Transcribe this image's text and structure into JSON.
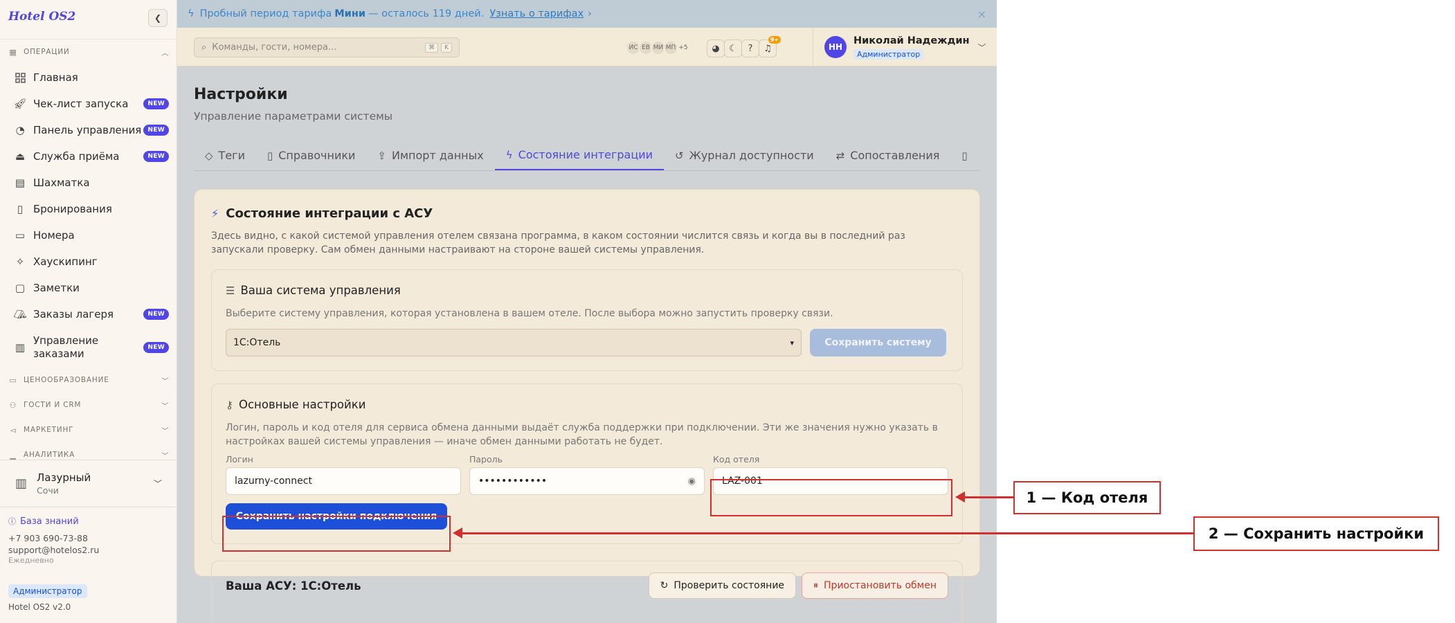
{
  "sidebar": {
    "brand": "Hotel OS2",
    "collapse_icon": "chevron-left-icon",
    "sections": {
      "operations": "ОПЕРАЦИИ",
      "pricing": "ЦЕНООБРАЗОВАНИЕ",
      "guests": "ГОСТИ И CRM",
      "marketing": "МАРКЕТИНГ",
      "analytics": "АНАЛИТИКА"
    },
    "items": [
      {
        "label": "Главная",
        "icon": "grid-icon",
        "badge": ""
      },
      {
        "label": "Чек-лист запуска",
        "icon": "rocket-icon",
        "badge": "NEW"
      },
      {
        "label": "Панель управления",
        "icon": "gauge-icon",
        "badge": "NEW"
      },
      {
        "label": "Служба приёма",
        "icon": "bell-icon",
        "badge": "NEW"
      },
      {
        "label": "Шахматка",
        "icon": "table-icon",
        "badge": ""
      },
      {
        "label": "Бронирования",
        "icon": "clipboard-icon",
        "badge": ""
      },
      {
        "label": "Номера",
        "icon": "door-icon",
        "badge": ""
      },
      {
        "label": "Хаускипинг",
        "icon": "sparkle-icon",
        "badge": ""
      },
      {
        "label": "Заметки",
        "icon": "note-icon",
        "badge": ""
      },
      {
        "label": "Заказы лагеря",
        "icon": "tent-icon",
        "badge": "NEW"
      },
      {
        "label": "Управление заказами",
        "icon": "receipt-icon",
        "badge": "NEW"
      }
    ],
    "hotel": {
      "name": "Лазурный",
      "city": "Сочи"
    },
    "footer": {
      "knowledge_base": "База знаний",
      "phone": "+7 903 690-73-88",
      "email": "support@hotelos2.ru",
      "hours": "Ежедневно",
      "role": "Администратор",
      "version": "Hotel OS2 v2.0"
    }
  },
  "trial_banner": {
    "text_before": "Пробный период тарифа",
    "plan": "Мини",
    "text_after": "— осталось 119 дней.",
    "link": "Узнать о тарифах",
    "link_arrow": "›",
    "close": "×"
  },
  "topbar": {
    "search_placeholder": "Команды, гости, номера...",
    "shortcut": [
      "⌘",
      "K"
    ],
    "avatars": [
      "ИС",
      "ЕВ",
      "МИ",
      "МП"
    ],
    "avatars_more": "+5",
    "notifications_count": "9+",
    "user": {
      "initials": "НН",
      "name": "Николай Надеждин",
      "role": "Администратор"
    }
  },
  "page": {
    "title": "Настройки",
    "subtitle": "Управление параметрами системы",
    "tabs": [
      {
        "label": "Теги",
        "icon": "tag-icon"
      },
      {
        "label": "Справочники",
        "icon": "book-icon"
      },
      {
        "label": "Импорт данных",
        "icon": "upload-icon"
      },
      {
        "label": "Состояние интеграции",
        "icon": "lightning-icon",
        "active": true
      },
      {
        "label": "Журнал доступности",
        "icon": "history-icon"
      },
      {
        "label": "Сопоставления",
        "icon": "swap-icon"
      }
    ]
  },
  "integration": {
    "title": "Состояние интеграции с АСУ",
    "description": "Здесь видно, с какой системой управления отелем связана программа, в каком состоянии числится связь и когда вы в последний раз запускали проверку. Сам обмен данными настраивают на стороне вашей системы управления.",
    "system_panel": {
      "title": "Ваша система управления",
      "description": "Выберите систему управления, которая установлена в вашем отеле. После выбора можно запустить проверку связи.",
      "selected": "1С:Отель",
      "save_button": "Сохранить систему"
    },
    "basic_panel": {
      "title": "Основные настройки",
      "description": "Логин, пароль и код отеля для сервиса обмена данными выдаёт служба поддержки при подключении. Эти же значения нужно указать в настройках вашей системы управления — иначе обмен данными работать не будет.",
      "login_label": "Логин",
      "login_value": "lazurny-connect",
      "password_label": "Пароль",
      "password_value": "••••••••••••",
      "hotel_code_label": "Код отеля",
      "hotel_code_value": "LAZ-001",
      "save_button": "Сохранить настройки подключения"
    },
    "status_panel": {
      "title": "Ваша АСУ: 1С:Отель",
      "check_button": "Проверить состояние",
      "pause_button": "Приостановить обмен"
    }
  },
  "annotations": {
    "callout1": "1 — Код отеля",
    "callout2": "2 — Сохранить настройки"
  },
  "colors": {
    "accent": "#4f46e5",
    "primary_button": "#1d4fd8",
    "annotation": "#d32f2f"
  }
}
